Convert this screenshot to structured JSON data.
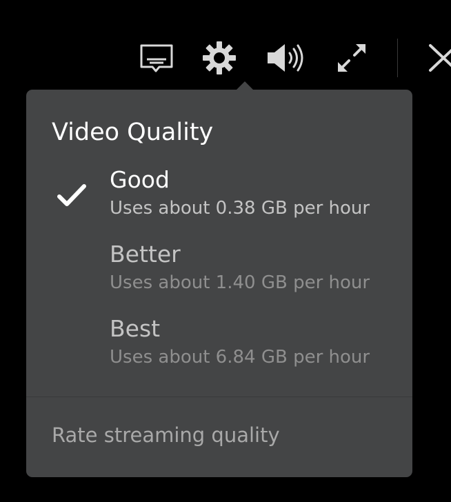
{
  "toolbar": {
    "icons": [
      "subtitles-icon",
      "gear-icon",
      "volume-icon",
      "fullscreen-icon",
      "close-icon"
    ]
  },
  "colors": {
    "background": "#000000",
    "panel": "#444546",
    "icon": "#d8d8d8",
    "title": "#ffffff",
    "selected_label": "#ffffff",
    "selected_sub": "#c4c4c4",
    "unselected_label": "#c4c4c4",
    "unselected_sub": "#8f8f8f",
    "link": "#a9a9a9"
  },
  "popover": {
    "title": "Video Quality",
    "options": [
      {
        "label": "Good",
        "description": "Uses about 0.38 GB per hour",
        "selected": true
      },
      {
        "label": "Better",
        "description": "Uses about 1.40 GB per hour",
        "selected": false
      },
      {
        "label": "Best",
        "description": "Uses about 6.84 GB per hour",
        "selected": false
      }
    ],
    "rate_link": "Rate streaming quality"
  }
}
